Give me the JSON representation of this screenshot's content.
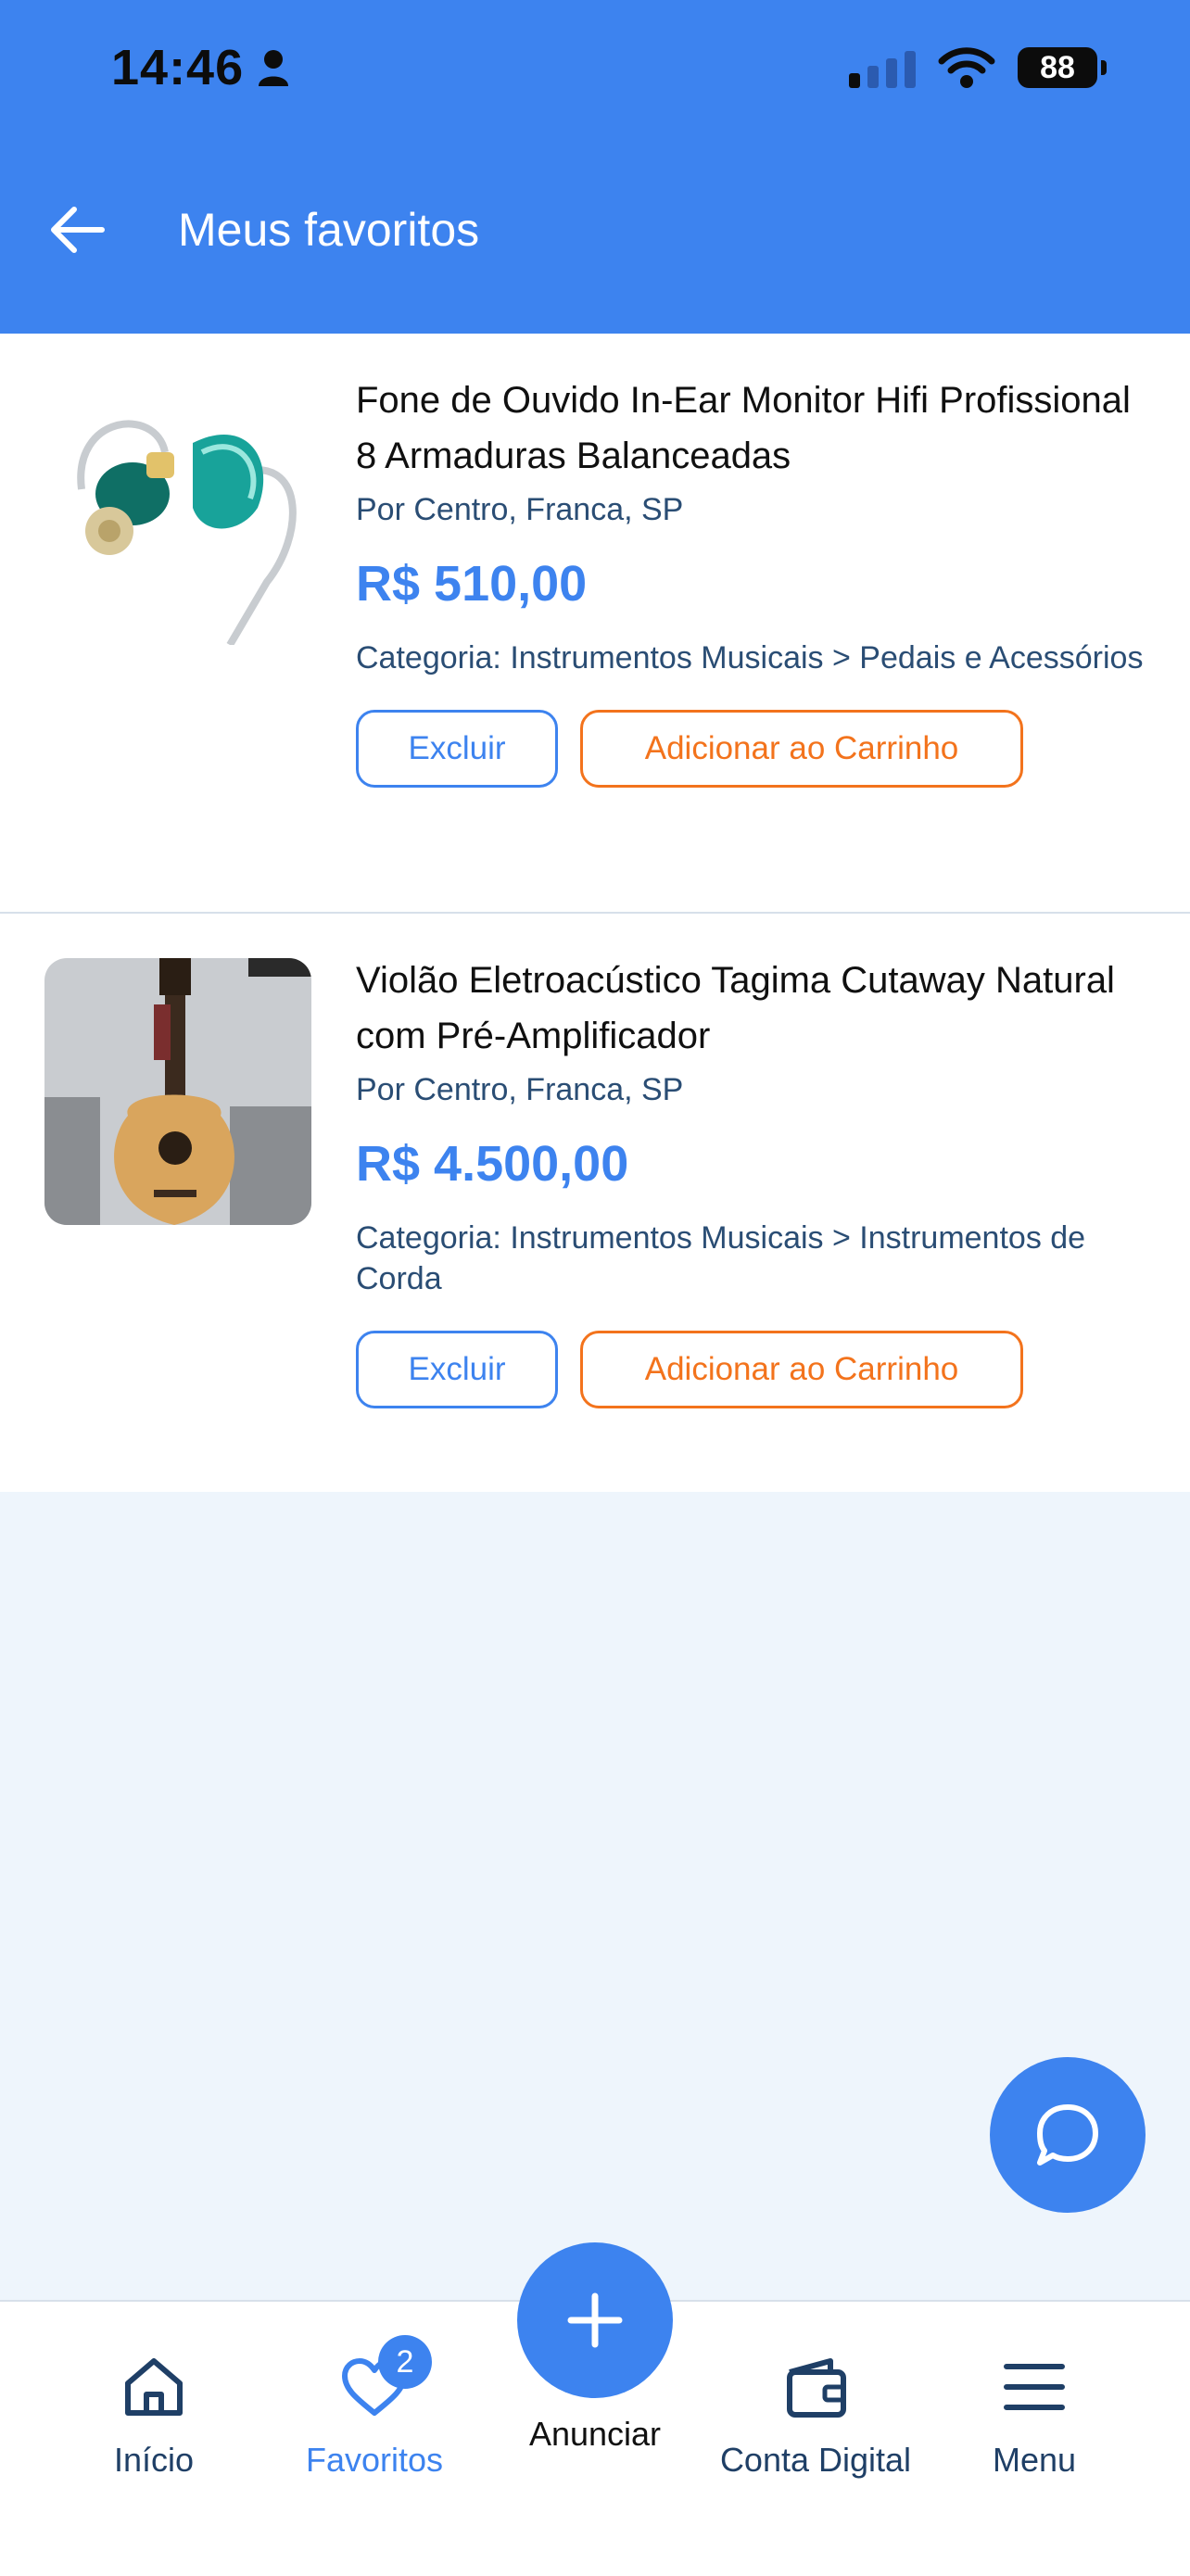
{
  "status_bar": {
    "time": "14:46",
    "battery": "88"
  },
  "header": {
    "title": "Meus favoritos"
  },
  "favorites": [
    {
      "name": "Fone de Ouvido In-Ear Monitor Hifi Profissional 8 Armaduras Balanceadas",
      "seller": "Por Centro, Franca, SP",
      "price": "R$ 510,00",
      "category": "Categoria: Instrumentos Musicais > Pedais e Acessórios",
      "remove_label": "Excluir",
      "cart_label": "Adicionar ao Carrinho"
    },
    {
      "name": "Violão Eletroacústico Tagima Cutaway Natural com Pré-Amplificador",
      "seller": "Por Centro, Franca, SP",
      "price": "R$ 4.500,00",
      "category": "Categoria: Instrumentos Musicais > Instrumentos de Corda",
      "remove_label": "Excluir",
      "cart_label": "Adicionar ao Carrinho"
    }
  ],
  "bottom_nav": {
    "home": "Início",
    "favorites": "Favoritos",
    "favorites_badge": "2",
    "post": "Anunciar",
    "wallet": "Conta Digital",
    "menu": "Menu"
  },
  "colors": {
    "primary": "#3d83ef",
    "accent": "#f3731c",
    "background": "#eef5fc"
  }
}
